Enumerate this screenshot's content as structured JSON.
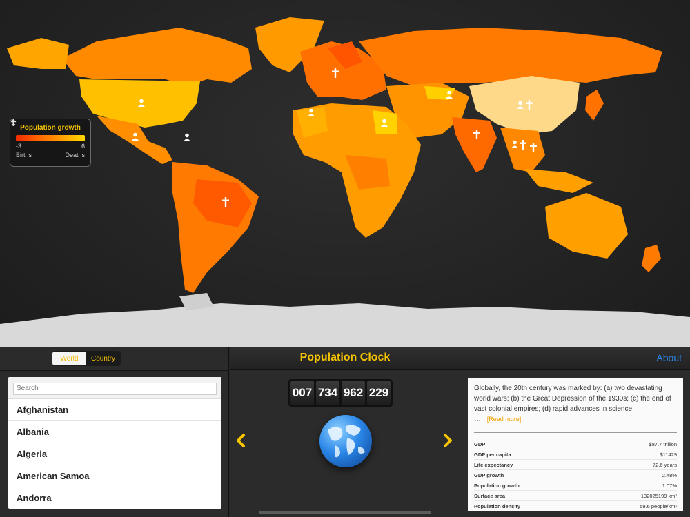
{
  "legend": {
    "title": "Population growth",
    "min": "-3",
    "max": "6",
    "births_label": "Births",
    "deaths_label": "Deaths"
  },
  "tabs": {
    "world": "World",
    "country": "Country",
    "selected": "World"
  },
  "search": {
    "placeholder": "Search"
  },
  "countries": [
    "Afghanistan",
    "Albania",
    "Algeria",
    "American Samoa",
    "Andorra"
  ],
  "header": {
    "title": "Population Clock",
    "about": "About"
  },
  "clock": {
    "groups": [
      "007",
      "734",
      "962",
      "229"
    ]
  },
  "info": {
    "description": "Globally, the 20th century was marked by: (a) two devastating world wars; (b) the Great Depression of the 1930s; (c) the end of vast colonial empires; (d) rapid advances in science",
    "ellipsis": "…",
    "read_more": "[Read more]",
    "stats": [
      {
        "label": "GDP",
        "value": "$87.7 trillion"
      },
      {
        "label": "GDP per capita",
        "value": "$11429"
      },
      {
        "label": "Life expectancy",
        "value": "72.6 years"
      },
      {
        "label": "GDP growth",
        "value": "2.48%"
      },
      {
        "label": "Population growth",
        "value": "1.07%"
      },
      {
        "label": "Surface area",
        "value": "132025199 km²"
      },
      {
        "label": "Population density",
        "value": "59.6 people/km²"
      }
    ]
  },
  "colors": {
    "accent": "#f6c400",
    "link": "#2a8bf2"
  }
}
